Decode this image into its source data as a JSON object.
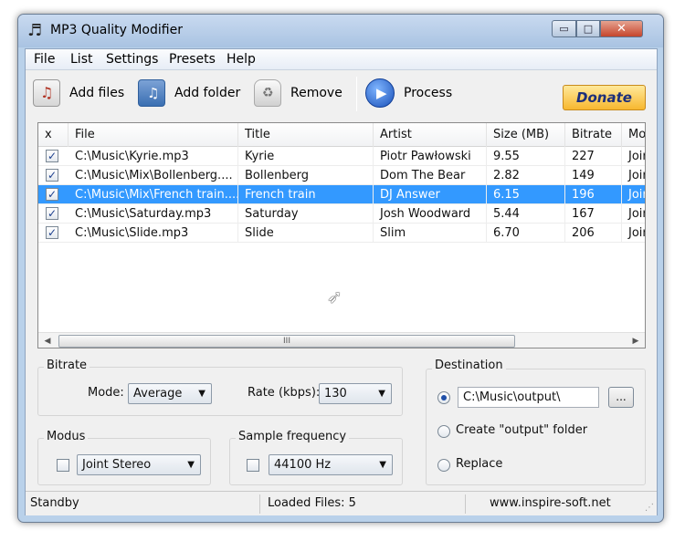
{
  "window": {
    "title": "MP3 Quality Modifier",
    "minimize_glyph": "▭",
    "maximize_glyph": "□",
    "close_glyph": "✕"
  },
  "menu": [
    "File",
    "List",
    "Settings",
    "Presets",
    "Help"
  ],
  "toolbar": {
    "add_files": "Add files",
    "add_folder": "Add folder",
    "remove": "Remove",
    "process": "Process",
    "donate": "Donate"
  },
  "list": {
    "columns": [
      "x",
      "File",
      "Title",
      "Artist",
      "Size (MB)",
      "Bitrate",
      "Mo"
    ],
    "rows": [
      {
        "checked": true,
        "file": "C:\\Music\\Kyrie.mp3",
        "title": "Kyrie",
        "artist": "Piotr Pawłowski",
        "size": "9.55",
        "bitrate": "227",
        "mode": "Joir"
      },
      {
        "checked": true,
        "file": "C:\\Music\\Mix\\Bollenberg....",
        "title": "Bollenberg",
        "artist": "Dom The Bear",
        "size": "2.82",
        "bitrate": "149",
        "mode": "Joir"
      },
      {
        "checked": true,
        "file": "C:\\Music\\Mix\\French train....",
        "title": "French train",
        "artist": "DJ Answer",
        "size": "6.15",
        "bitrate": "196",
        "mode": "Joir",
        "selected": true
      },
      {
        "checked": true,
        "file": "C:\\Music\\Saturday.mp3",
        "title": "Saturday",
        "artist": "Josh Woodward",
        "size": "5.44",
        "bitrate": "167",
        "mode": "Joir"
      },
      {
        "checked": true,
        "file": "C:\\Music\\Slide.mp3",
        "title": "Slide",
        "artist": "Slim",
        "size": "6.70",
        "bitrate": "206",
        "mode": "Joir"
      }
    ],
    "scroll_grip": "III",
    "check_glyph": "✓"
  },
  "bitrate": {
    "title": "Bitrate",
    "mode_label": "Mode:",
    "mode_value": "Average",
    "rate_label": "Rate (kbps):",
    "rate_value": "130"
  },
  "modus": {
    "title": "Modus",
    "value": "Joint Stereo",
    "checked": false
  },
  "sample": {
    "title": "Sample frequency",
    "value": "44100 Hz",
    "checked": false
  },
  "destination": {
    "title": "Destination",
    "path": "C:\\Music\\output\\",
    "browse": "...",
    "option_create": "Create \"output\" folder",
    "option_replace": "Replace",
    "selected": "path"
  },
  "status": {
    "state": "Standby",
    "loaded": "Loaded Files: 5",
    "website": "www.inspire-soft.net"
  }
}
